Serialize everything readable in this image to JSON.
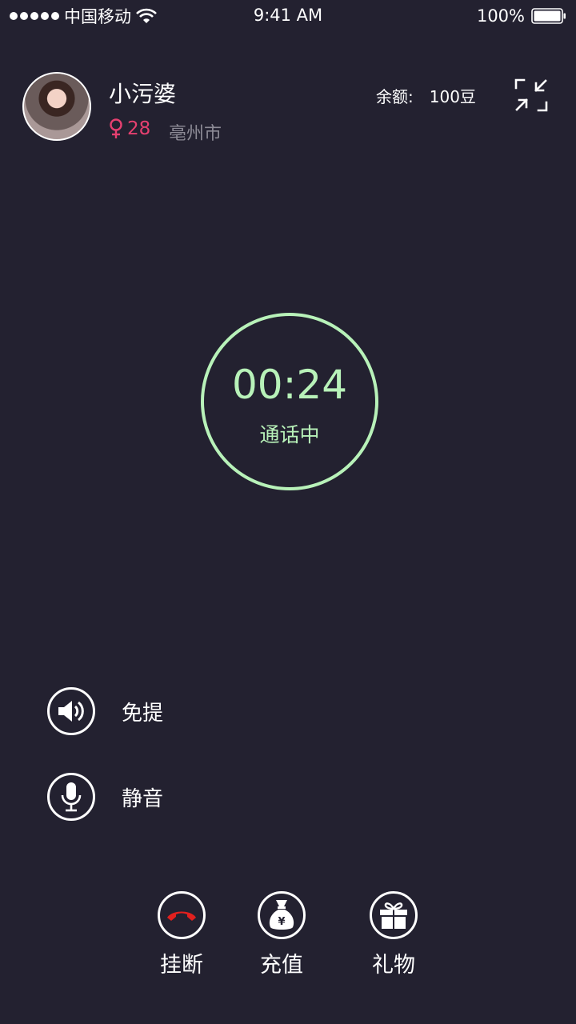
{
  "status_bar": {
    "carrier": "中国移动",
    "time": "9:41 AM",
    "battery": "100%"
  },
  "caller": {
    "name": "小污婆",
    "gender_symbol": "♀",
    "age": "28",
    "location": "亳州市"
  },
  "balance": {
    "label": "余额:",
    "value": "100豆"
  },
  "call": {
    "timer": "00:24",
    "status": "通话中",
    "ring_color": "#b8f2b9"
  },
  "options": [
    {
      "label": "免提",
      "icon": "speaker-icon"
    },
    {
      "label": "静音",
      "icon": "microphone-icon"
    }
  ],
  "actions": [
    {
      "label": "挂断",
      "icon": "hangup-icon",
      "color": "#e0201e"
    },
    {
      "label": "充值",
      "icon": "money-bag-icon"
    },
    {
      "label": "礼物",
      "icon": "gift-icon"
    }
  ],
  "colors": {
    "background": "#232130",
    "accent_green": "#b8f2b9",
    "gender_pink": "#e64070"
  }
}
